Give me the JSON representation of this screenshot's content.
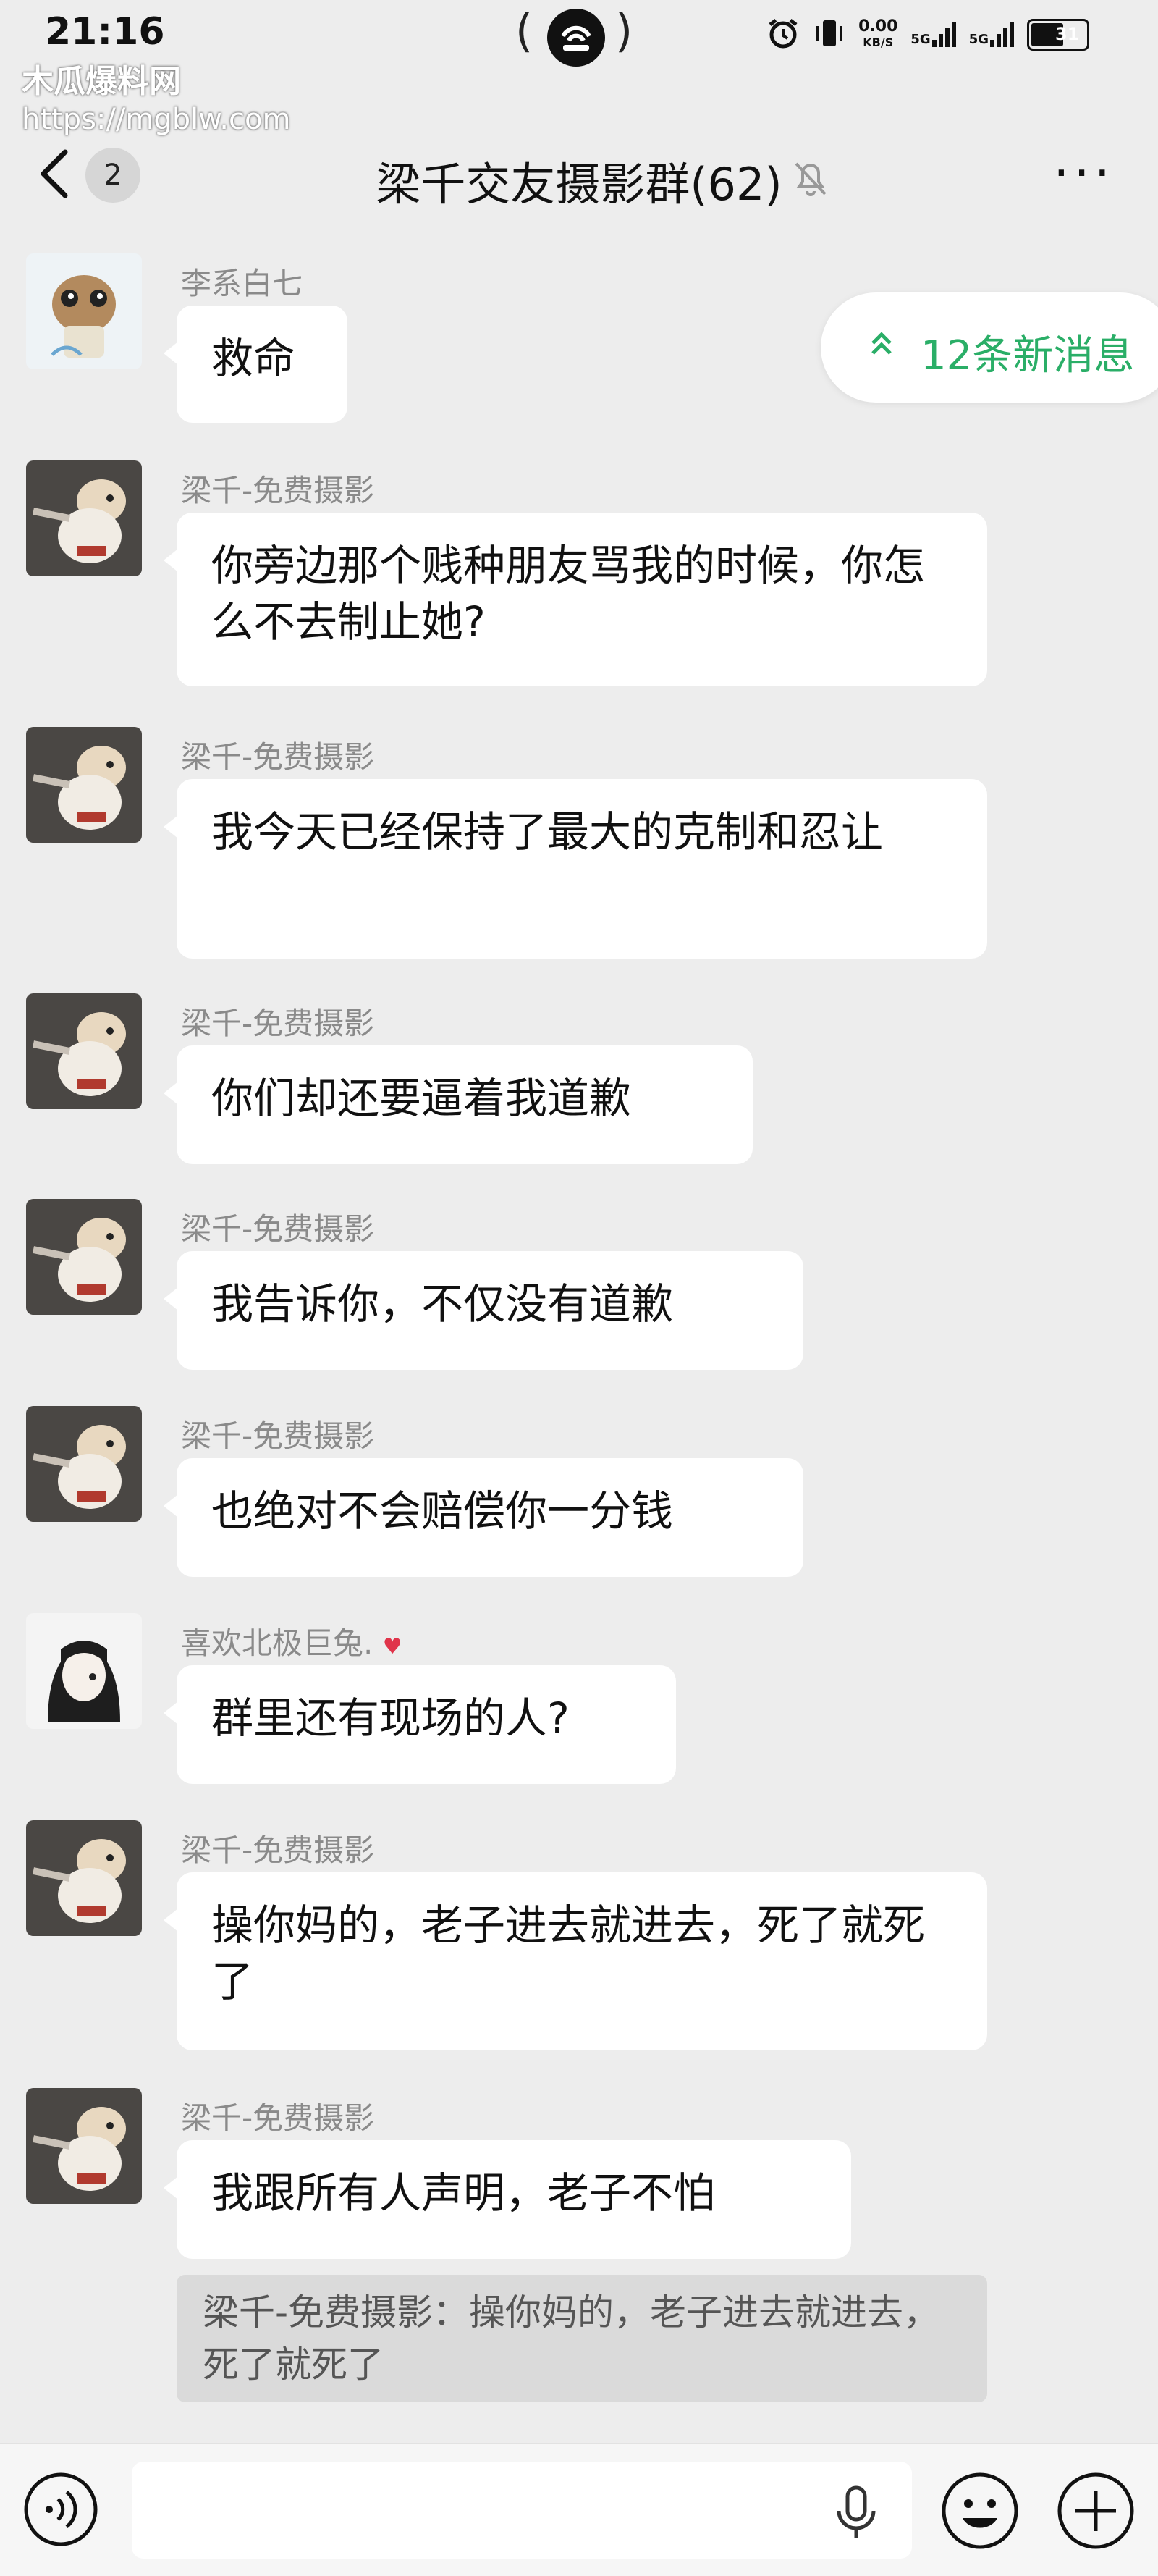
{
  "status": {
    "time": "21:16",
    "net_speed_value": "0.00",
    "net_speed_unit": "KB/S",
    "sim1": "5G",
    "sim2": "5G",
    "battery": "31"
  },
  "watermark": {
    "name": "木瓜爆料网",
    "url": "https://mgblw.com"
  },
  "header": {
    "unread_count": "2",
    "title": "梁千交友摄影群(62)",
    "more": "···"
  },
  "new_messages_pill": "12条新消息",
  "messages": [
    {
      "sender": "李系白七",
      "text": "救命",
      "avatar": "cartoon-avatar"
    },
    {
      "sender": "梁千-免费摄影",
      "text": "你旁边那个贱种朋友骂我的时候，你怎么不去制止她?",
      "avatar": "dog-avatar"
    },
    {
      "sender": "梁千-免费摄影",
      "text": "我今天已经保持了最大的克制和忍让",
      "avatar": "dog-avatar"
    },
    {
      "sender": "梁千-免费摄影",
      "text": "你们却还要逼着我道歉",
      "avatar": "dog-avatar"
    },
    {
      "sender": "梁千-免费摄影",
      "text": "我告诉你，不仅没有道歉",
      "avatar": "dog-avatar"
    },
    {
      "sender": "梁千-免费摄影",
      "text": "也绝对不会赔偿你一分钱",
      "avatar": "dog-avatar"
    },
    {
      "sender": "喜欢北极巨兔.",
      "text": "群里还有现场的人?",
      "avatar": "anime-avatar"
    },
    {
      "sender": "梁千-免费摄影",
      "text": "操你妈的，老子进去就进去，死了就死了",
      "avatar": "dog-avatar"
    },
    {
      "sender": "梁千-免费摄影",
      "text": "我跟所有人声明，老子不怕",
      "avatar": "dog-avatar"
    }
  ],
  "quote": "梁千-免费摄影：操你妈的，老子进去就进去，死了就死了",
  "colors": {
    "background": "#ededed",
    "bubble": "#ffffff",
    "accent_green": "#2aae67"
  }
}
